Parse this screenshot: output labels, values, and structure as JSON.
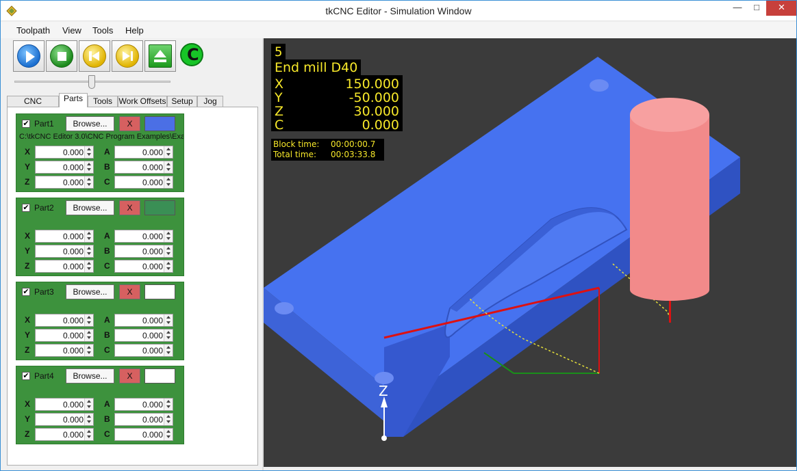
{
  "window": {
    "title": "tkCNC Editor - Simulation Window",
    "min_glyph": "—",
    "max_glyph": "□",
    "close_glyph": "✕"
  },
  "menu": [
    "Toolpath",
    "View",
    "Tools",
    "Help"
  ],
  "toolbar": {
    "icons": [
      "play-icon",
      "stop-icon",
      "rewind-icon",
      "forward-icon",
      "eject-icon",
      "logo-c-icon"
    ],
    "logo_letter": "C"
  },
  "slider": {
    "value_fraction": 0.5
  },
  "tabs": [
    "CNC Program",
    "Parts",
    "Tools",
    "Work Offsets",
    "Setup",
    "Jog"
  ],
  "active_tab": "Parts",
  "parts": [
    {
      "name": "Part1",
      "checked": true,
      "browse": "Browse...",
      "remove": "X",
      "color": "#4b6fe5",
      "path": "C:\\tkCNC Editor 3.0\\CNC Program Examples\\Exam",
      "X": "0.000",
      "Y": "0.000",
      "Z": "0.000",
      "A": "0.000",
      "B": "0.000",
      "C": "0.000"
    },
    {
      "name": "Part2",
      "checked": true,
      "browse": "Browse...",
      "remove": "X",
      "color": "#3a8f55",
      "path": "",
      "X": "0.000",
      "Y": "0.000",
      "Z": "0.000",
      "A": "0.000",
      "B": "0.000",
      "C": "0.000"
    },
    {
      "name": "Part3",
      "checked": true,
      "browse": "Browse...",
      "remove": "X",
      "color": "#ffffff",
      "path": "",
      "X": "0.000",
      "Y": "0.000",
      "Z": "0.000",
      "A": "0.000",
      "B": "0.000",
      "C": "0.000"
    },
    {
      "name": "Part4",
      "checked": true,
      "browse": "Browse...",
      "remove": "X",
      "color": "#ffffff",
      "path": "",
      "X": "0.000",
      "Y": "0.000",
      "Z": "0.000",
      "A": "0.000",
      "B": "0.000",
      "C": "0.000"
    }
  ],
  "axis_labels": {
    "X": "X",
    "Y": "Y",
    "Z": "Z",
    "A": "A",
    "B": "B",
    "C": "C"
  },
  "sim": {
    "line_number": "5",
    "tool_name": "End mill D40",
    "coords": [
      {
        "axis": "X",
        "value": "150.000"
      },
      {
        "axis": "Y",
        "value": "-50.000"
      },
      {
        "axis": "Z",
        "value": "30.000"
      },
      {
        "axis": "C",
        "value": "0.000"
      }
    ],
    "block_time_label": "Block time:",
    "block_time": "00:00:00.7",
    "total_time_label": "Total time:",
    "total_time": "00:03:33.8",
    "view_axis_label": "Z",
    "colors": {
      "background": "#3b3b3b",
      "workpiece": "#4672f0",
      "tool": "#f28a8a",
      "osd_text": "#f7e82a"
    }
  }
}
